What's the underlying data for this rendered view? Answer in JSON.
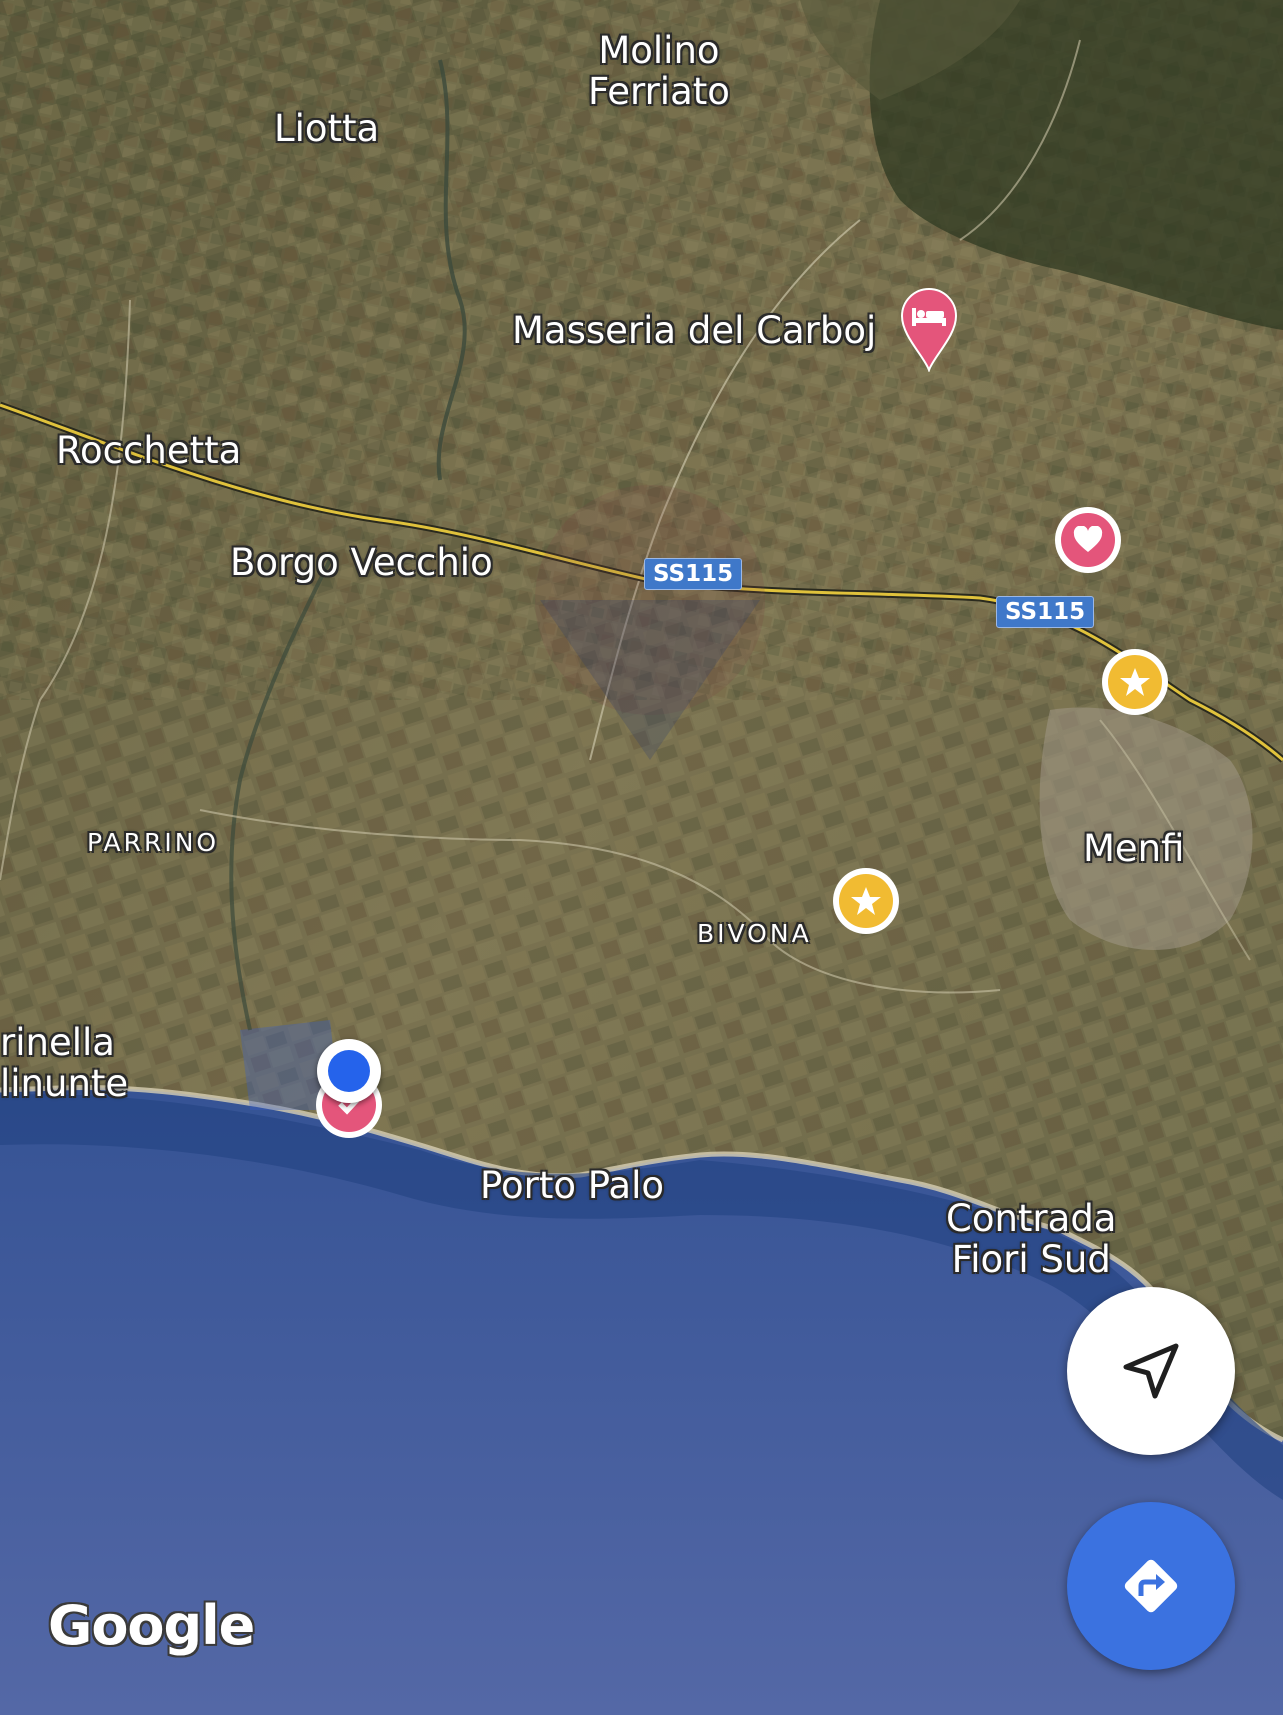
{
  "map": {
    "provider_logo": "Google",
    "place_labels": {
      "molino": "Molino",
      "ferriato": "Ferriato",
      "liotta": "Liotta",
      "masseria": "Masseria del Carboj",
      "rocchetta": "Rocchetta",
      "borgo_vecchio": "Borgo Vecchio",
      "parrino": "PARRINO",
      "bivona": "BIVONA",
      "menfi": "Menfi",
      "marinella": "rinella",
      "selinunte": "linunte",
      "porto_palo": "Porto Palo",
      "contrada": "Contrada",
      "fiori_sud": "Fiori Sud"
    },
    "road_shields": [
      "SS115",
      "SS115"
    ],
    "poi_icons": {
      "hotel": "hotel-bed-icon",
      "favorite": "heart-icon",
      "starred_1": "star-icon",
      "starred_2": "star-icon",
      "current_location": "location-dot-icon",
      "saved": "check-icon"
    },
    "colors": {
      "sea": "#1e3a72",
      "land": "#6e6a45",
      "road": "#e0c23c",
      "pink_marker": "#e4557b",
      "gold_marker": "#f1bb32",
      "location_blue": "#2563eb",
      "fab_blue": "#3b72e0"
    }
  },
  "controls": {
    "compass_icon": "navigation-arrow-icon",
    "directions_icon": "directions-icon"
  }
}
